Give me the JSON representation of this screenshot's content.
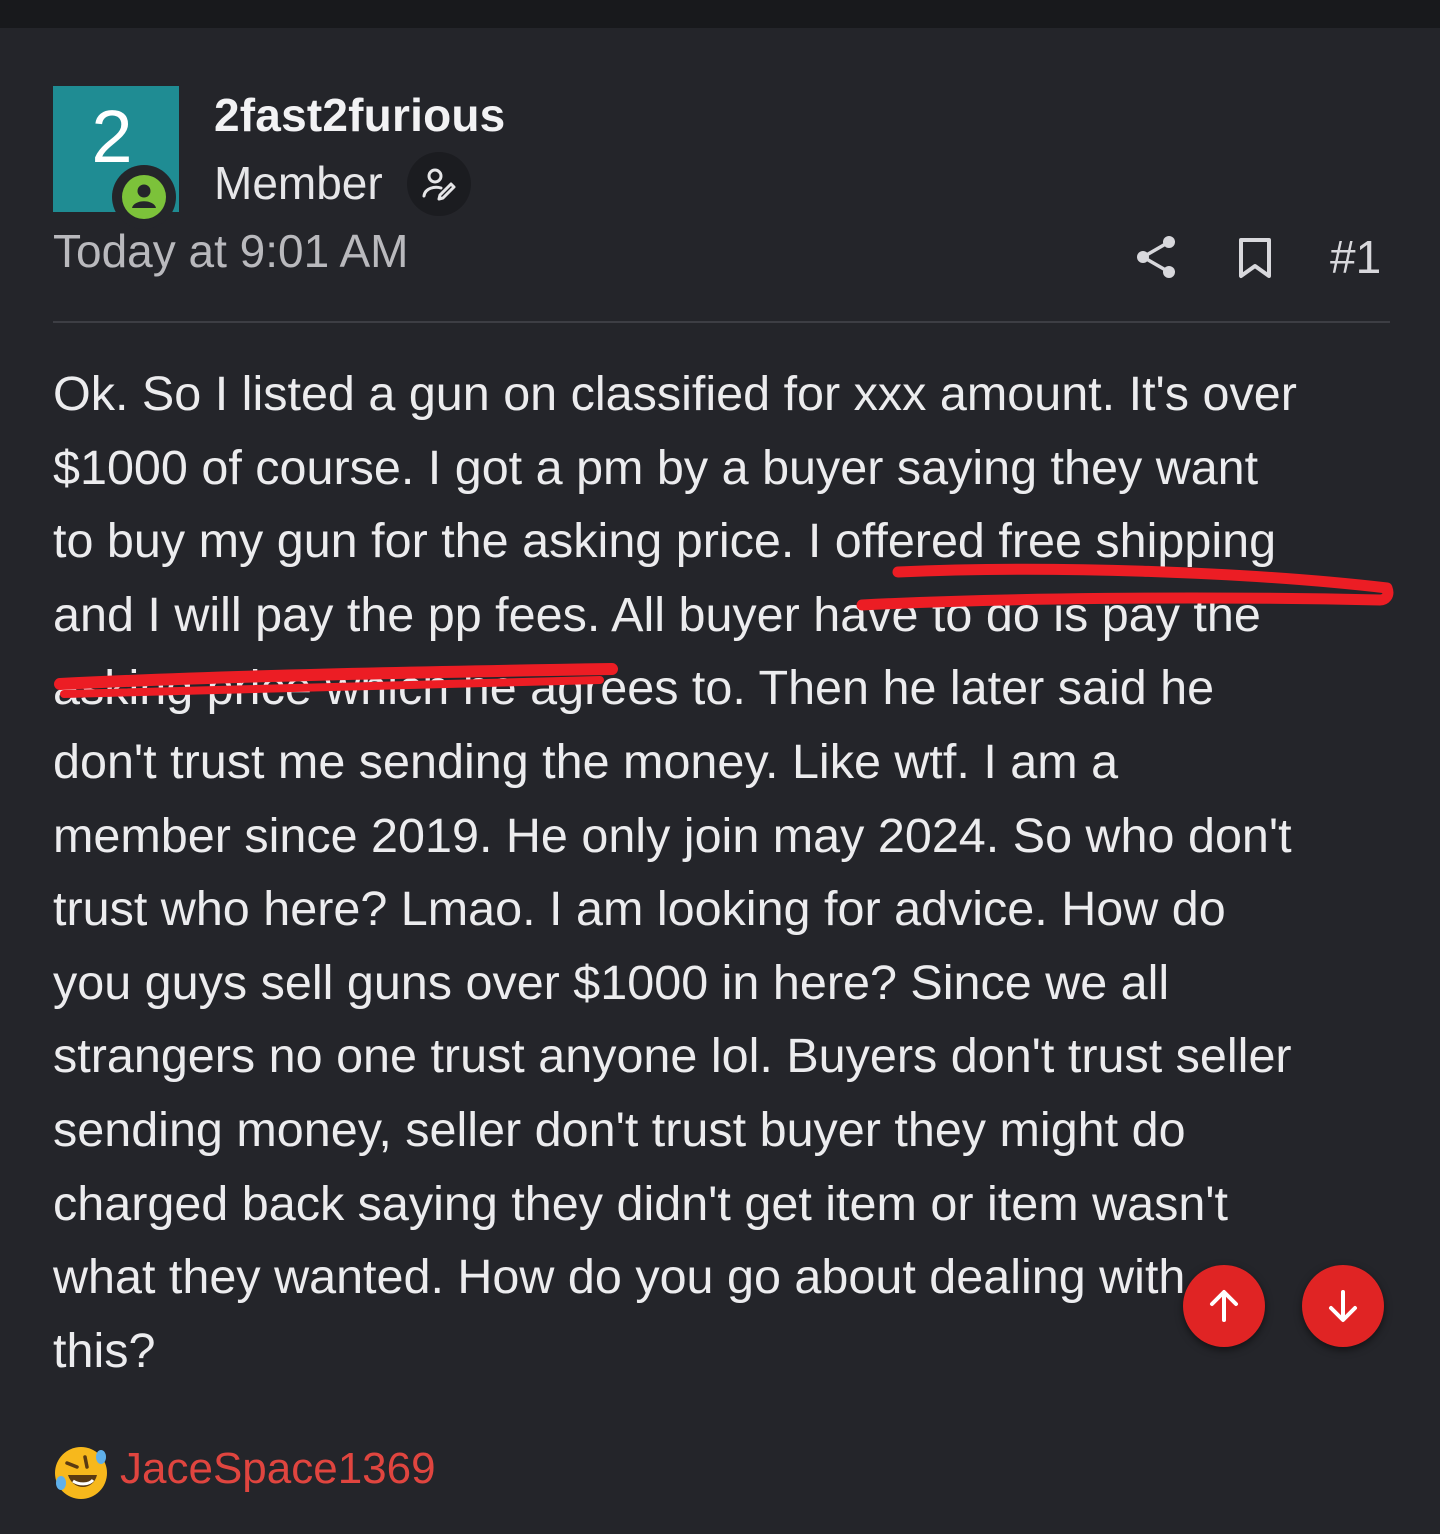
{
  "post": {
    "avatar_letter": "2",
    "username": "2fast2furious",
    "role": "Member",
    "timestamp": "Today at 9:01 AM",
    "post_number": "#1",
    "body_lines": [
      "Ok. So I listed a gun on classified for xxx amount. It's over",
      "$1000 of course. I got a pm by a buyer saying they want",
      "to buy my gun for the asking price. I offered free shipping",
      "and I will pay the pp fees. All buyer have to do is pay the",
      "asking price which he agrees to. Then he later said he",
      "don't trust me sending the money. Like wtf. I am a",
      "member since 2019. He only join may 2024. So who don't",
      "trust who here? Lmao. I am looking for advice. How do",
      "you guys sell guns over $1000 in here? Since we all",
      "strangers no one trust anyone lol. Buyers don't trust seller",
      "sending money, seller don't trust buyer they might do",
      "charged back saying they didn't get item or item wasn't",
      "what they wanted. How do you go about dealing with",
      "this?"
    ]
  },
  "reactions": {
    "user": "JaceSpace1369",
    "icon": "laughing-emoji-icon"
  },
  "icons": {
    "online": "online-status-icon",
    "role": "user-edit-icon",
    "share": "share-icon",
    "bookmark": "bookmark-icon",
    "scroll_up": "arrow-up-icon",
    "scroll_down": "arrow-down-icon"
  },
  "colors": {
    "background": "#24252a",
    "avatar": "#1f8c93",
    "online": "#7cc23a",
    "scribble": "#ec1d24",
    "fab": "#e02424",
    "reaction_user": "#e0453f"
  }
}
